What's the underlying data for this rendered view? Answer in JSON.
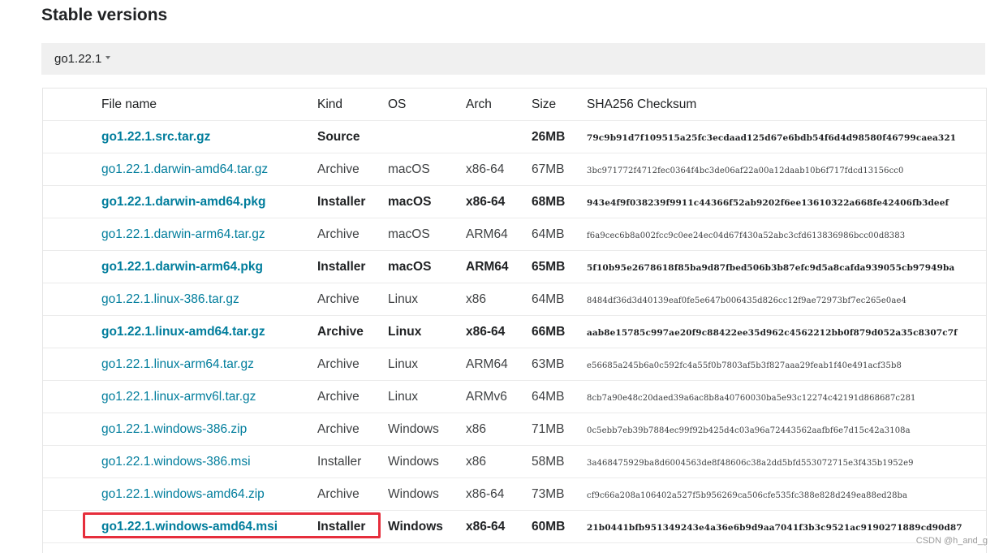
{
  "section": {
    "title": "Stable versions"
  },
  "version_toggle": {
    "label": "go1.22.1"
  },
  "table": {
    "headers": {
      "file": "File name",
      "kind": "Kind",
      "os": "OS",
      "arch": "Arch",
      "size": "Size",
      "checksum": "SHA256 Checksum"
    },
    "rows": [
      {
        "file": "go1.22.1.src.tar.gz",
        "kind": "Source",
        "os": "",
        "arch": "",
        "size": "26MB",
        "checksum": "79c9b91d7f109515a25fc3ecdaad125d67e6bdb54f6d4d98580f46799caea321",
        "bold": true
      },
      {
        "file": "go1.22.1.darwin-amd64.tar.gz",
        "kind": "Archive",
        "os": "macOS",
        "arch": "x86-64",
        "size": "67MB",
        "checksum": "3bc971772f4712fec0364f4bc3de06af22a00a12daab10b6f717fdcd13156cc0",
        "bold": false
      },
      {
        "file": "go1.22.1.darwin-amd64.pkg",
        "kind": "Installer",
        "os": "macOS",
        "arch": "x86-64",
        "size": "68MB",
        "checksum": "943e4f9f038239f9911c44366f52ab9202f6ee13610322a668fe42406fb3deef",
        "bold": true
      },
      {
        "file": "go1.22.1.darwin-arm64.tar.gz",
        "kind": "Archive",
        "os": "macOS",
        "arch": "ARM64",
        "size": "64MB",
        "checksum": "f6a9cec6b8a002fcc9c0ee24ec04d67f430a52abc3cfd613836986bcc00d8383",
        "bold": false
      },
      {
        "file": "go1.22.1.darwin-arm64.pkg",
        "kind": "Installer",
        "os": "macOS",
        "arch": "ARM64",
        "size": "65MB",
        "checksum": "5f10b95e2678618f85ba9d87fbed506b3b87efc9d5a8cafda939055cb97949ba",
        "bold": true
      },
      {
        "file": "go1.22.1.linux-386.tar.gz",
        "kind": "Archive",
        "os": "Linux",
        "arch": "x86",
        "size": "64MB",
        "checksum": "8484df36d3d40139eaf0fe5e647b006435d826cc12f9ae72973bf7ec265e0ae4",
        "bold": false
      },
      {
        "file": "go1.22.1.linux-amd64.tar.gz",
        "kind": "Archive",
        "os": "Linux",
        "arch": "x86-64",
        "size": "66MB",
        "checksum": "aab8e15785c997ae20f9c88422ee35d962c4562212bb0f879d052a35c8307c7f",
        "bold": true
      },
      {
        "file": "go1.22.1.linux-arm64.tar.gz",
        "kind": "Archive",
        "os": "Linux",
        "arch": "ARM64",
        "size": "63MB",
        "checksum": "e56685a245b6a0c592fc4a55f0b7803af5b3f827aaa29feab1f40e491acf35b8",
        "bold": false
      },
      {
        "file": "go1.22.1.linux-armv6l.tar.gz",
        "kind": "Archive",
        "os": "Linux",
        "arch": "ARMv6",
        "size": "64MB",
        "checksum": "8cb7a90e48c20daed39a6ac8b8a40760030ba5e93c12274c42191d868687c281",
        "bold": false
      },
      {
        "file": "go1.22.1.windows-386.zip",
        "kind": "Archive",
        "os": "Windows",
        "arch": "x86",
        "size": "71MB",
        "checksum": "0c5ebb7eb39b7884ec99f92b425d4c03a96a72443562aafbf6e7d15c42a3108a",
        "bold": false
      },
      {
        "file": "go1.22.1.windows-386.msi",
        "kind": "Installer",
        "os": "Windows",
        "arch": "x86",
        "size": "58MB",
        "checksum": "3a468475929ba8d6004563de8f48606c38a2dd5bfd553072715e3f435b1952e9",
        "bold": false
      },
      {
        "file": "go1.22.1.windows-amd64.zip",
        "kind": "Archive",
        "os": "Windows",
        "arch": "x86-64",
        "size": "73MB",
        "checksum": "cf9c66a208a106402a527f5b956269ca506cfe535fc388e828d249ea88ed28ba",
        "bold": false
      },
      {
        "file": "go1.22.1.windows-amd64.msi",
        "kind": "Installer",
        "os": "Windows",
        "arch": "x86-64",
        "size": "60MB",
        "checksum": "21b0441bfb951349243e4a36e6b9d9aa7041f3b3c9521ac9190271889cd90d87",
        "bold": true
      }
    ]
  },
  "highlight": {
    "color": "#e62e3c"
  },
  "watermark": {
    "text": "CSDN @h_and_g"
  },
  "colors": {
    "link": "#007d9c",
    "version_bar": "#f0f0f0"
  },
  "icons": {
    "version_toggle": "caret-down-icon"
  }
}
